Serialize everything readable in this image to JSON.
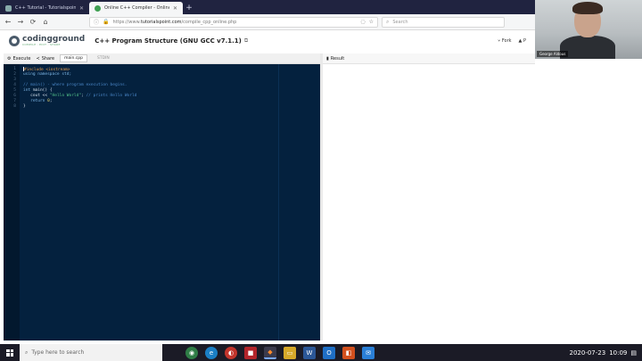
{
  "browser": {
    "tabs": [
      {
        "title": "C++ Tutorial - Tutorialspoint",
        "active": false
      },
      {
        "title": "Online C++ Compiler - Online",
        "active": true
      }
    ],
    "url_prefix": "https://www.",
    "url_domain": "tutorialspoint.com",
    "url_path": "/compile_cpp_online.php",
    "search_placeholder": "Search"
  },
  "webcam": {
    "name_tag": "George Aldous"
  },
  "site": {
    "logo_main": "codingground",
    "logo_sub": "COMPILE . EDIT . SHARE",
    "title": "C++ Program Structure (GNU GCC v7.1.1)",
    "fork_label": "Fork",
    "more_label": "P"
  },
  "editor": {
    "execute_label": "Execute",
    "share_label": "Share",
    "file_tab": "main.cpp",
    "stdin_tab": "STDIN",
    "result_label": "Result",
    "lines": [
      [
        {
          "t": "#include <iostream>",
          "c": "pre"
        }
      ],
      [
        {
          "t": "using namespace std;",
          "c": "kw"
        }
      ],
      [],
      [
        {
          "t": "// main() - where program execution begins.",
          "c": "cm"
        }
      ],
      [
        {
          "t": "int",
          "c": "kw"
        },
        {
          "t": " main() {",
          "c": "id"
        }
      ],
      [
        {
          "t": "   cout << ",
          "c": "id"
        },
        {
          "t": "\"Hello World\"",
          "c": "str"
        },
        {
          "t": "; ",
          "c": "id"
        },
        {
          "t": "// prints Hello World",
          "c": "cm"
        }
      ],
      [
        {
          "t": "   return ",
          "c": "kw"
        },
        {
          "t": "0",
          "c": "num"
        },
        {
          "t": ";",
          "c": "id"
        }
      ],
      [
        {
          "t": "}",
          "c": "id"
        }
      ]
    ]
  },
  "taskbar": {
    "search_placeholder": "Type here to search",
    "date": "2020-07-23",
    "time": "10:09"
  }
}
